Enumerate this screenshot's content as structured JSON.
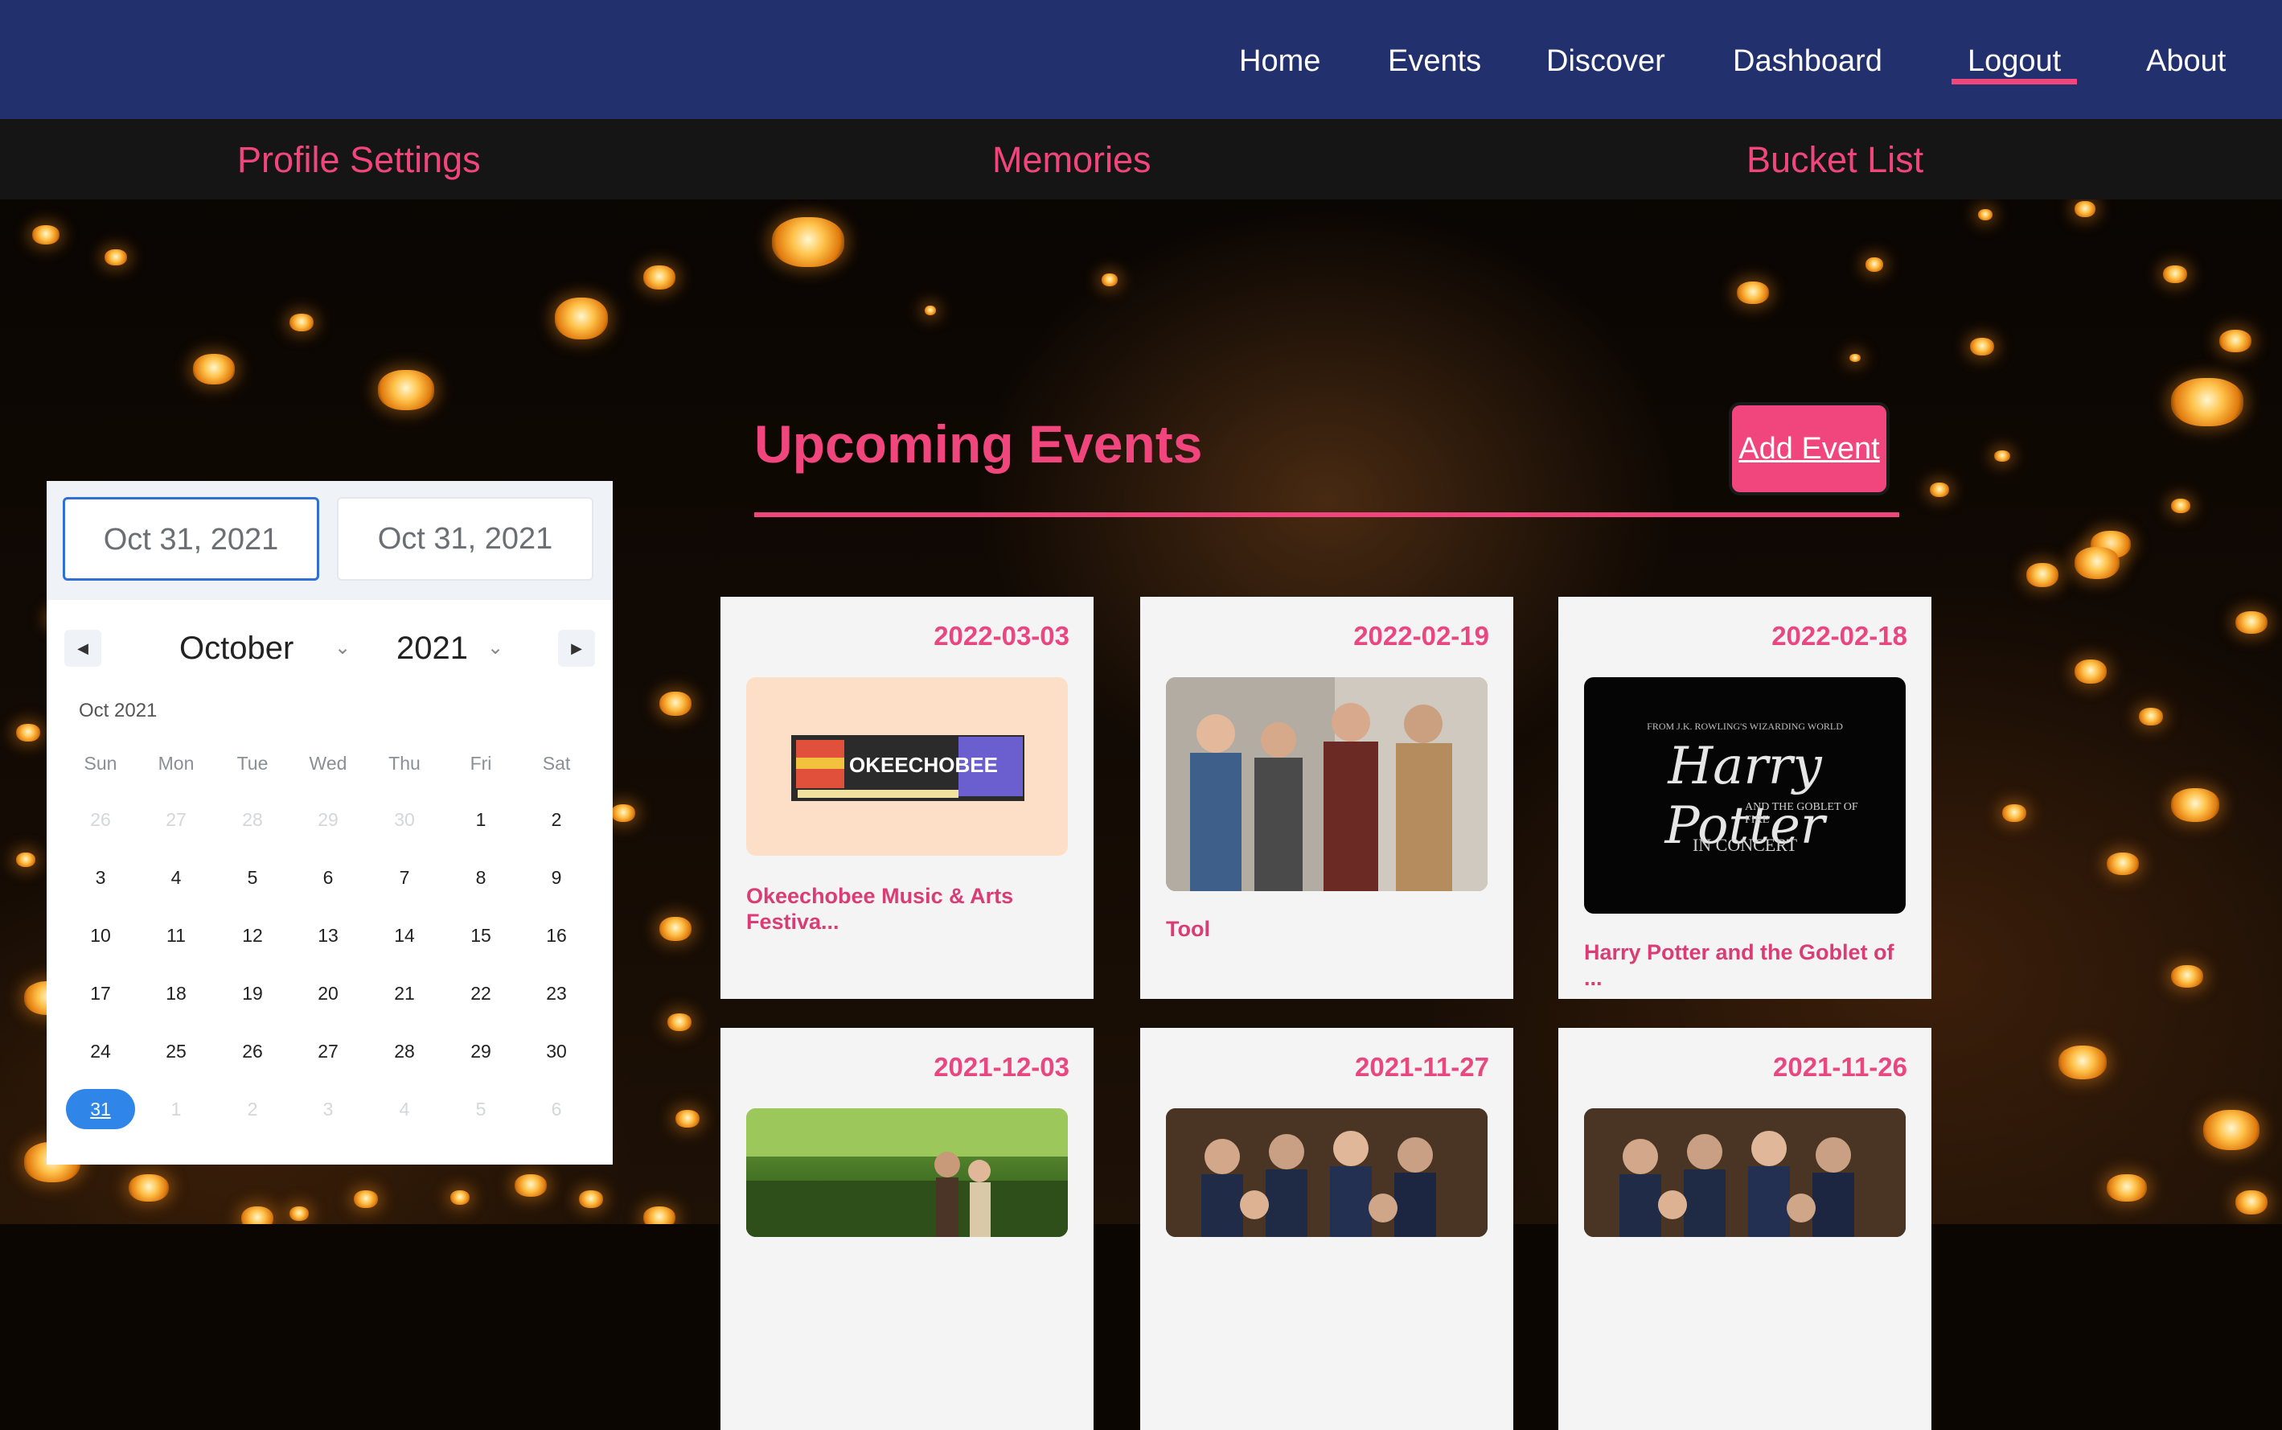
{
  "nav": {
    "items": [
      {
        "key": "home",
        "label": "Home"
      },
      {
        "key": "events",
        "label": "Events"
      },
      {
        "key": "discover",
        "label": "Discover"
      },
      {
        "key": "dashboard",
        "label": "Dashboard"
      },
      {
        "key": "logout",
        "label": "Logout",
        "active": true
      },
      {
        "key": "about",
        "label": "About"
      }
    ]
  },
  "subnav": {
    "items": [
      {
        "key": "profile-settings",
        "label": "Profile Settings"
      },
      {
        "key": "memories",
        "label": "Memories"
      },
      {
        "key": "bucket-list",
        "label": "Bucket List"
      }
    ]
  },
  "datepicker": {
    "start_value": "Oct 31, 2021",
    "end_value": "Oct 31, 2021",
    "month": "October",
    "year": "2021",
    "caption": "Oct 2021",
    "weekdays": [
      "Sun",
      "Mon",
      "Tue",
      "Wed",
      "Thu",
      "Fri",
      "Sat"
    ],
    "weeks": [
      [
        "26",
        "27",
        "28",
        "29",
        "30",
        "1",
        "2"
      ],
      [
        "3",
        "4",
        "5",
        "6",
        "7",
        "8",
        "9"
      ],
      [
        "10",
        "11",
        "12",
        "13",
        "14",
        "15",
        "16"
      ],
      [
        "17",
        "18",
        "19",
        "20",
        "21",
        "22",
        "23"
      ],
      [
        "24",
        "25",
        "26",
        "27",
        "28",
        "29",
        "30"
      ],
      [
        "31",
        "1",
        "2",
        "3",
        "4",
        "5",
        "6"
      ]
    ],
    "selected_day": "31"
  },
  "main": {
    "title": "Upcoming Events",
    "add_button_label": "Add Event"
  },
  "events": [
    {
      "date": "2022-03-03",
      "name": "Okeechobee Music & Arts Festiva...",
      "image": "okeechobee-logo"
    },
    {
      "date": "2022-02-19",
      "name": "Tool",
      "image": "band-photo"
    },
    {
      "date": "2022-02-18",
      "name": "Harry Potter and the Goblet of ...",
      "image": "harry-potter-poster"
    },
    {
      "date": "2021-12-03",
      "name": "",
      "image": "couple-in-forest"
    },
    {
      "date": "2021-11-27",
      "name": "",
      "image": "group-photo"
    },
    {
      "date": "2021-11-26",
      "name": "",
      "image": "group-photo"
    }
  ],
  "harry_potter_poster": {
    "line1": "FROM J.K. ROWLING'S WIZARDING WORLD",
    "title": "Harry Potter",
    "subtitle": "AND THE GOBLET OF FIRE",
    "tagline": "IN CONCERT"
  },
  "okeechobee_logo": {
    "text": "OKEECHOBEE"
  },
  "colors": {
    "nav_bg": "#22306e",
    "accent": "#f0457d",
    "subnav_bg": "#151515",
    "card_bg": "#f4f4f4",
    "selected_day": "#2f86e8"
  }
}
